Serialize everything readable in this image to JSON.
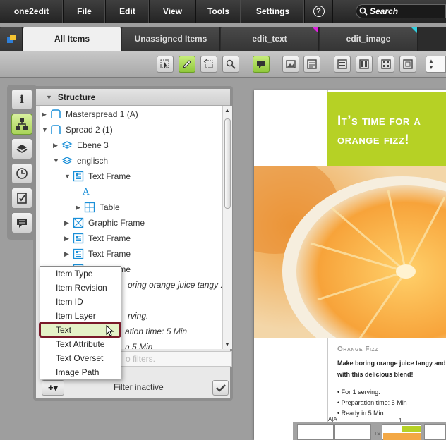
{
  "menubar": {
    "items": [
      {
        "label": "one2edit",
        "name": "menu-one2edit"
      },
      {
        "label": "File",
        "name": "menu-file"
      },
      {
        "label": "Edit",
        "name": "menu-edit"
      },
      {
        "label": "View",
        "name": "menu-view"
      },
      {
        "label": "Tools",
        "name": "menu-tools"
      },
      {
        "label": "Settings",
        "name": "menu-settings"
      },
      {
        "label": "?",
        "name": "menu-help"
      }
    ],
    "search_placeholder": "Search"
  },
  "tabs": [
    {
      "label": "All Items",
      "active": true
    },
    {
      "label": "Unassigned Items",
      "active": false
    },
    {
      "label": "edit_text",
      "corner_color": "#e020e0"
    },
    {
      "label": "edit_image",
      "corner_color": "#30d0e0"
    }
  ],
  "toolbar": {
    "tools": [
      "select-tool-icon",
      "pencil-tool-icon",
      "frame-tool-icon",
      "zoom-tool-icon",
      "comment-tool-icon",
      "image-view-icon",
      "text-view-icon",
      "layout-1-icon",
      "layout-2-icon",
      "layout-3-icon",
      "layout-4-icon"
    ],
    "active": [
      "pencil-tool-icon",
      "comment-tool-icon"
    ]
  },
  "sidebar": {
    "buttons": [
      "info-icon",
      "structure-icon",
      "layers-icon",
      "history-icon",
      "tasks-icon",
      "comments-icon"
    ],
    "active": "structure-icon"
  },
  "structure": {
    "title": "Structure",
    "tree": [
      {
        "label": "Masterspread 1 (A)",
        "indent": 0,
        "expander": "▶",
        "icon": "spread-icon"
      },
      {
        "label": "Spread 2 (1)",
        "indent": 0,
        "expander": "▼",
        "icon": "spread-icon"
      },
      {
        "label": "Ebene 3",
        "indent": 1,
        "expander": "▶",
        "icon": "layer-icon"
      },
      {
        "label": "englisch",
        "indent": 1,
        "expander": "▼",
        "icon": "layer-icon"
      },
      {
        "label": "Text Frame",
        "indent": 2,
        "expander": "▼",
        "icon": "text-frame-icon"
      },
      {
        "label": "",
        "indent": 3,
        "expander": "",
        "icon": "text-glyph-icon"
      },
      {
        "label": "Table",
        "indent": 3,
        "expander": "▶",
        "icon": "table-icon"
      },
      {
        "label": "Graphic Frame",
        "indent": 2,
        "expander": "▶",
        "icon": "graphic-frame-icon"
      },
      {
        "label": "Text Frame",
        "indent": 2,
        "expander": "▶",
        "icon": "text-frame-icon"
      },
      {
        "label": "Text Frame",
        "indent": 2,
        "expander": "▶",
        "icon": "text-frame-icon"
      },
      {
        "label": "Text Frame",
        "indent": 2,
        "expander": "▼",
        "icon": "text-frame-icon"
      }
    ],
    "partial_lines": [
      "oring orange juice tangy ...",
      "rving.",
      "ation time: 5 Min",
      "n 5 Min"
    ],
    "text_glyph": "A",
    "filter_placeholder": "o filters.",
    "filter_status": "Filter inactive",
    "add_button": "+▾"
  },
  "dropdown": {
    "items": [
      "Item Type",
      "Item Revision",
      "Item ID",
      "Item Layer",
      "Text",
      "Text Attribute",
      "Text Overset",
      "Image Path"
    ],
    "selected": "Text"
  },
  "document": {
    "headline_1": "It’s time for a",
    "headline_2": "orange fizz!",
    "section_title": "Orange Fizz",
    "body_1": "Make boring orange juice tangy and fiz",
    "body_2": "with this delicious blend!",
    "bullets": [
      "• For 1 serving.",
      "• Preparation time: 5 Min",
      "• Ready in 5 Min"
    ],
    "page_marker": "A|A",
    "page_number": "1",
    "thumb_label": "TS"
  },
  "colors": {
    "accent_green": "#b6d125",
    "selected_border": "#7a1a2a"
  }
}
